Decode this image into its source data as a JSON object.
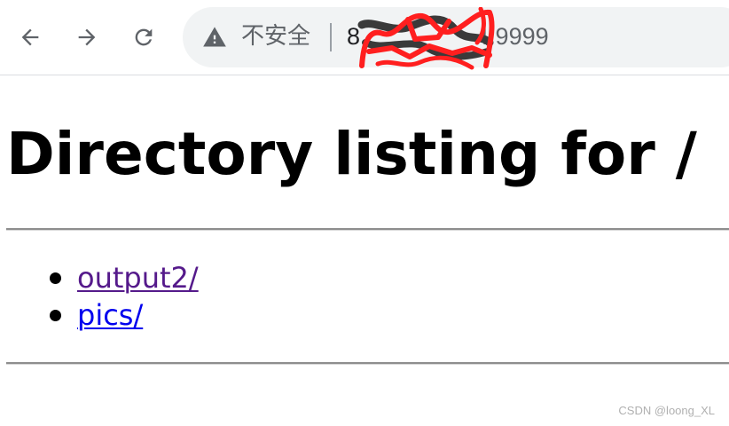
{
  "browser": {
    "back_icon": "arrow-left-icon",
    "forward_icon": "arrow-right-icon",
    "reload_icon": "reload-icon",
    "security_icon": "warning-triangle-icon",
    "security_label": "不安全",
    "url_prefix": "8",
    "url_suffix": "4:9999",
    "icon_color": "#5f6368",
    "omnibox_bg": "#f1f3f4",
    "redaction_color": "#ff1f1f"
  },
  "page": {
    "heading": "Directory listing for /",
    "entries": [
      {
        "label": "output2/",
        "visited": true
      },
      {
        "label": "pics/",
        "visited": false
      }
    ],
    "visited_link_color": "#551a8b",
    "link_color": "#0000ee"
  },
  "watermark": "CSDN @loong_XL"
}
